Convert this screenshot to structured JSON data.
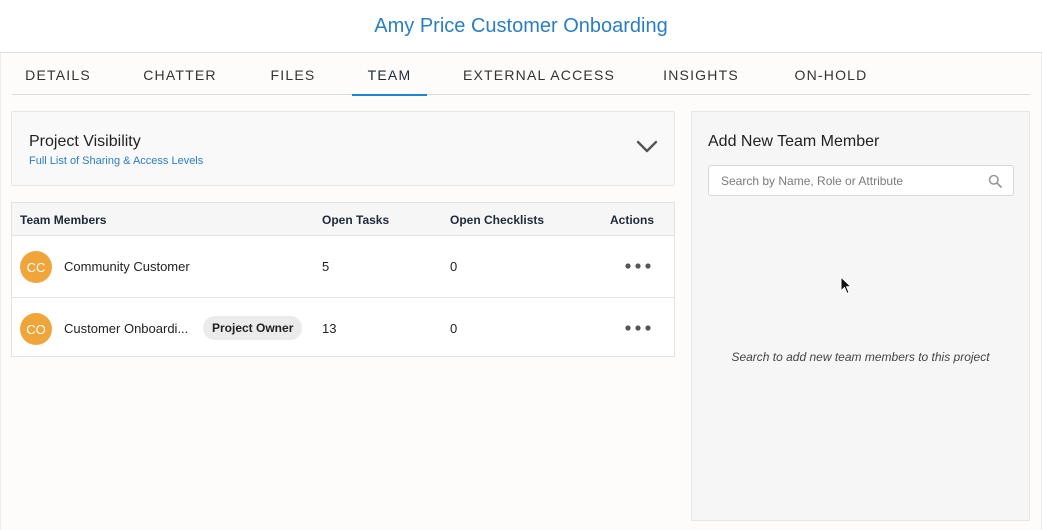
{
  "header": {
    "title": "Amy Price Customer Onboarding"
  },
  "tabs": [
    {
      "label": "DETAILS",
      "active": false
    },
    {
      "label": "CHATTER",
      "active": false
    },
    {
      "label": "FILES",
      "active": false
    },
    {
      "label": "TEAM",
      "active": true
    },
    {
      "label": "EXTERNAL ACCESS",
      "active": false
    },
    {
      "label": "INSIGHTS",
      "active": false
    },
    {
      "label": "ON-HOLD",
      "active": false
    }
  ],
  "visibility": {
    "title": "Project Visibility",
    "link": "Full List of Sharing & Access Levels"
  },
  "table": {
    "headers": {
      "members": "Team Members",
      "tasks": "Open Tasks",
      "checklists": "Open Checklists",
      "actions": "Actions"
    },
    "rows": [
      {
        "initials": "CC",
        "name": "Community Customer",
        "badge": "",
        "tasks": "5",
        "checklists": "0"
      },
      {
        "initials": "CO",
        "name": "Customer Onboardi...",
        "badge": "Project Owner",
        "tasks": "13",
        "checklists": "0"
      }
    ]
  },
  "add_member": {
    "title": "Add New Team Member",
    "search_placeholder": "Search by Name, Role or Attribute",
    "hint": "Search to add new team members to this project"
  },
  "colors": {
    "accent": "#1b87d4",
    "title_blue": "#2a7ec4",
    "avatar": "#f0a53a"
  },
  "icons": {
    "visibility_toggle": "chevron-down-icon",
    "row_actions": "more-horizontal-icon",
    "search": "search-icon",
    "cursor": "mouse-pointer-icon"
  }
}
